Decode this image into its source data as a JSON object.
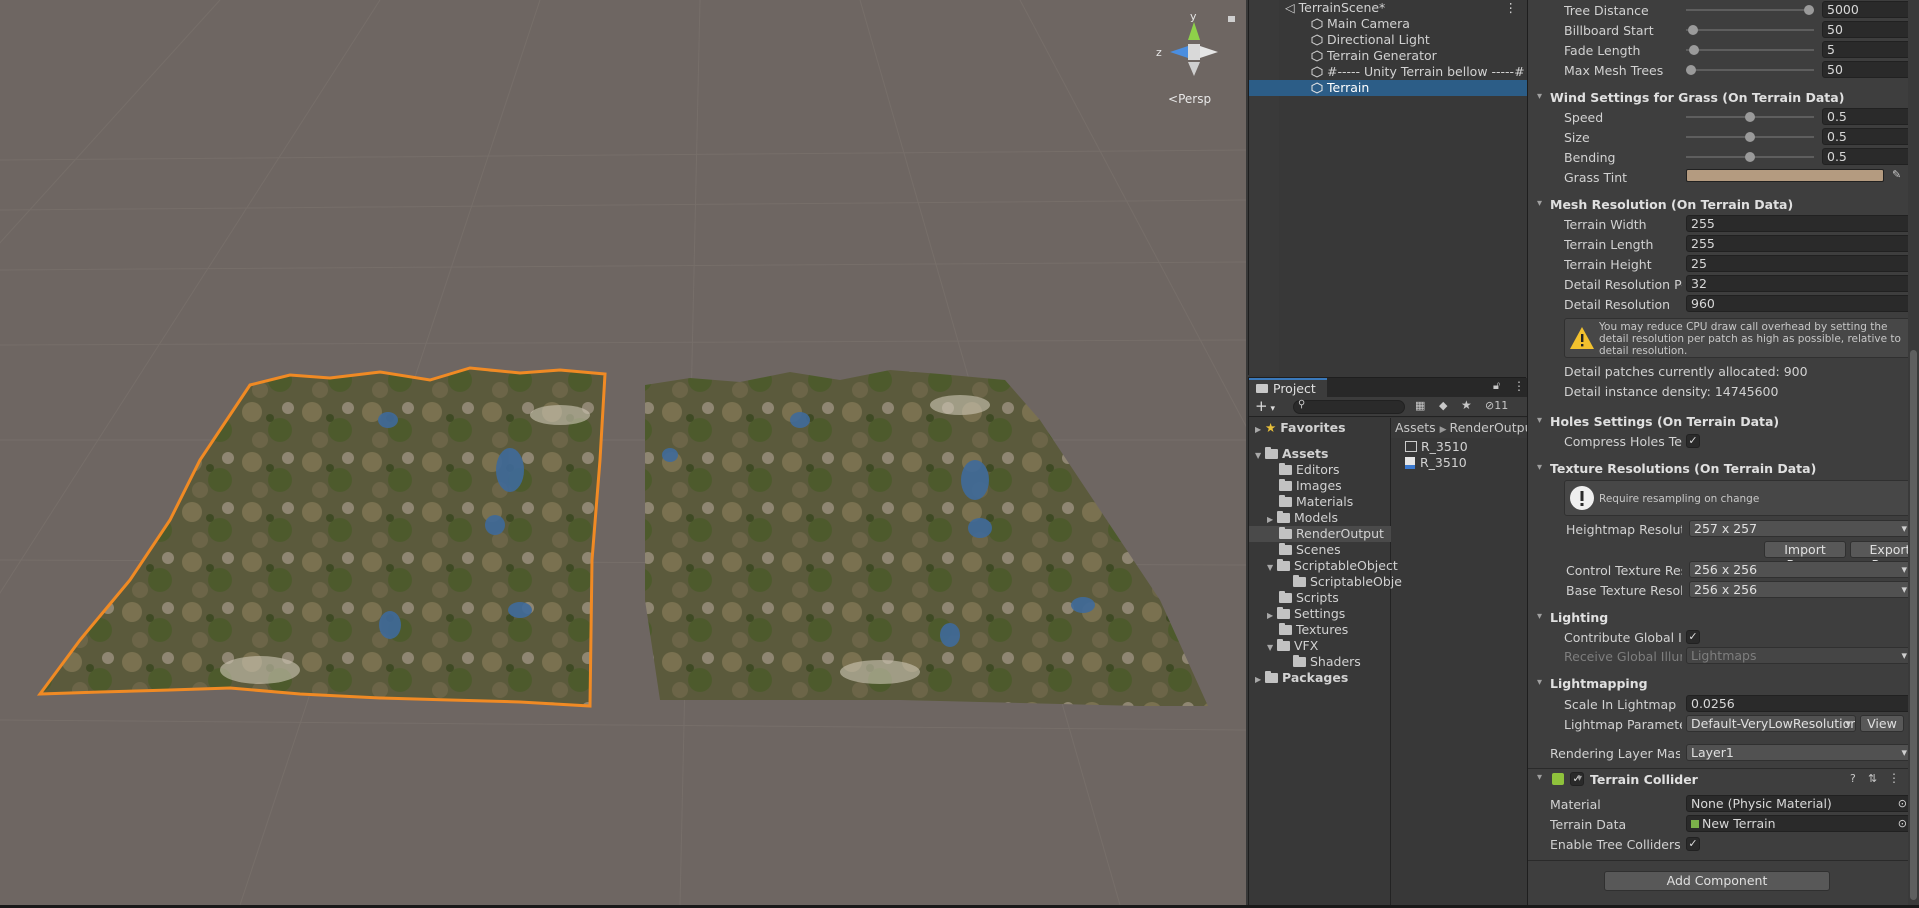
{
  "scene": {
    "persp_label": "Persp",
    "gizmo": {
      "y": "y",
      "z": "z"
    }
  },
  "hierarchy": {
    "scene_name": "TerrainScene*",
    "items": [
      {
        "label": "Main Camera",
        "selected": false
      },
      {
        "label": "Directional Light",
        "selected": false
      },
      {
        "label": "Terrain Generator",
        "selected": false
      },
      {
        "label": "#----- Unity Terrain bellow -----#",
        "selected": false
      },
      {
        "label": "Terrain",
        "selected": true
      }
    ]
  },
  "project": {
    "tab_label": "Project",
    "hidden_count": "11",
    "tree": {
      "favorites": "Favorites",
      "assets": "Assets",
      "folders": [
        "Editors",
        "Images",
        "Materials",
        "Models",
        "RenderOutput",
        "Scenes",
        "ScriptableObject",
        "ScriptableObje",
        "Scripts",
        "Settings",
        "Textures",
        "VFX",
        "Shaders"
      ],
      "packages": "Packages"
    },
    "breadcrumb": [
      "Assets",
      "RenderOutpu"
    ],
    "files": [
      "R_3510",
      "R_3510"
    ]
  },
  "inspector": {
    "tree_settings": [
      {
        "label": "Tree Distance",
        "value": "5000",
        "fraction": 1.0
      },
      {
        "label": "Billboard Start",
        "value": "50",
        "fraction": 0.02
      },
      {
        "label": "Fade Length",
        "value": "5",
        "fraction": 0.025
      },
      {
        "label": "Max Mesh Trees",
        "value": "50",
        "fraction": 0.0
      }
    ],
    "wind_header": "Wind Settings for Grass (On Terrain Data)",
    "wind": [
      {
        "label": "Speed",
        "value": "0.5",
        "fraction": 0.5
      },
      {
        "label": "Size",
        "value": "0.5",
        "fraction": 0.5
      },
      {
        "label": "Bending",
        "value": "0.5",
        "fraction": 0.5
      }
    ],
    "grass_tint_label": "Grass Tint",
    "grass_tint_color": "#b49b80",
    "mesh_header": "Mesh Resolution (On Terrain Data)",
    "mesh": [
      {
        "label": "Terrain Width",
        "value": "255"
      },
      {
        "label": "Terrain Length",
        "value": "255"
      },
      {
        "label": "Terrain Height",
        "value": "25"
      },
      {
        "label": "Detail Resolution Per",
        "value": "32"
      },
      {
        "label": "Detail Resolution",
        "value": "960"
      }
    ],
    "mesh_warning": "You may reduce CPU draw call overhead by setting the detail resolution per patch as high as possible, relative to detail resolution.",
    "patches_allocated": "Detail patches currently allocated: 900",
    "instance_density": "Detail instance density: 14745600",
    "holes_header": "Holes Settings (On Terrain Data)",
    "compress_holes_label": "Compress Holes Text",
    "texres_header": "Texture Resolutions (On Terrain Data)",
    "resample_note": "Require resampling on change",
    "heightmap_label": "Heightmap Resolution",
    "heightmap_value": "257 x 257",
    "import_raw": "Import Raw...",
    "export_raw": "Export Raw...",
    "control_tex_label": "Control Texture Resol",
    "control_tex_value": "256 x 256",
    "base_tex_label": "Base Texture Resolut",
    "base_tex_value": "256 x 256",
    "lighting_header": "Lighting",
    "contribute_gi_label": "Contribute Global Illum",
    "receive_gi_label": "Receive Global Illumi",
    "receive_gi_value": "Lightmaps",
    "lightmapping_header": "Lightmapping",
    "scale_lightmap_label": "Scale In Lightmap",
    "scale_lightmap_value": "0.0256",
    "lightmap_params_label": "Lightmap Parameters",
    "lightmap_params_value": "Default-VeryLowResolution",
    "view_button": "View",
    "rendering_layer_label": "Rendering Layer Mask",
    "rendering_layer_value": "Layer1",
    "collider_title": "Terrain Collider",
    "material_label": "Material",
    "material_value": "None (Physic Material)",
    "terrain_data_label": "Terrain Data",
    "terrain_data_value": "New Terrain",
    "tree_colliders_label": "Enable Tree Colliders",
    "add_component": "Add Component"
  },
  "colors": {
    "selection": "#2c5d87",
    "selection_outline": "#f08a24",
    "scene_bg": "#6e6662"
  }
}
